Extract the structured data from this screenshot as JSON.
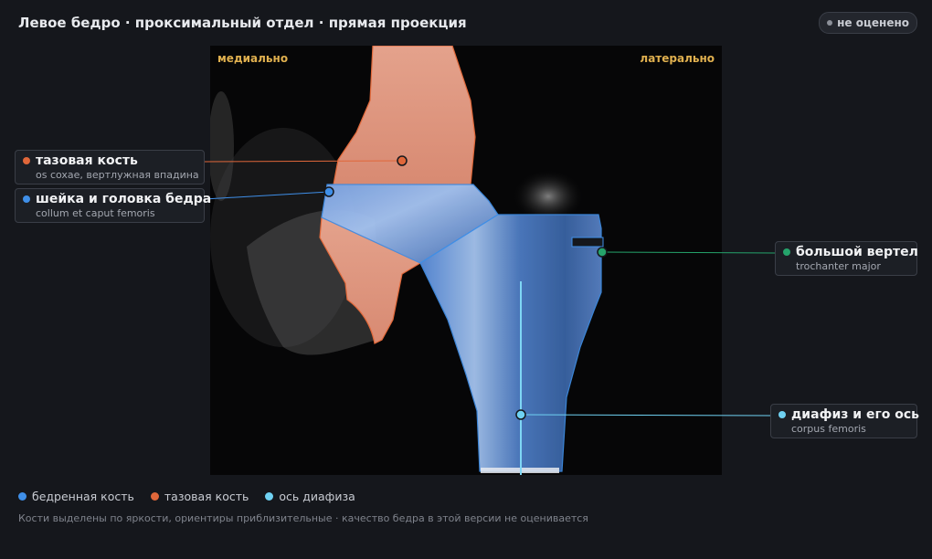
{
  "header": {
    "title": "Левое бедро · проксимальный отдел · прямая проекция",
    "status_badge": "не оценено"
  },
  "image": {
    "corner_left": "медиально",
    "corner_right": "латерально"
  },
  "annotations": [
    {
      "id": "pelvis",
      "name": "тазовая кость",
      "sub": "os coxae, вертлужная впадина",
      "color": "#e0673a"
    },
    {
      "id": "neck",
      "name": "шейка и головка бедра",
      "sub": "collum et caput femoris",
      "color": "#3f8fe8"
    },
    {
      "id": "trochanter",
      "name": "большой вертел",
      "sub": "trochanter major",
      "color": "#25a36b"
    },
    {
      "id": "shaft",
      "name": "диафиз и его ось",
      "sub": "corpus femoris",
      "color": "#6fd1f2"
    }
  ],
  "legend": [
    {
      "label": "бедренная кость",
      "color": "#3f8fe8"
    },
    {
      "label": "тазовая кость",
      "color": "#e0673a"
    },
    {
      "label": "ось диафиза",
      "color": "#6fd1f2"
    }
  ],
  "footnote": "Кости выделены по яркости, ориентиры приблизительные · качество бедра в этой версии не оценивается",
  "colors": {
    "background": "#15171c",
    "accent_corner": "#e0b04f",
    "femur_fill": "#4a78c0",
    "pelvis_fill": "#e6a38c"
  }
}
